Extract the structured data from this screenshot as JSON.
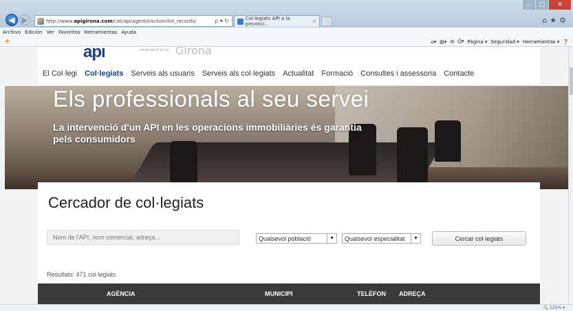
{
  "browser": {
    "url_prefix": "http://www.",
    "url_host": "apigirona.com",
    "url_path": "/cat/api/agent/i/action/list_records/",
    "url_tools": "ρ ▾ ↻",
    "tab_title": "Col·legiats API a la provinci...",
    "tab_close": "×",
    "menu": [
      "Archivo",
      "Edición",
      "Ver",
      "Favoritos",
      "Herramientas",
      "Ayuda"
    ],
    "command_bar": [
      "Página ▾",
      "Seguridad ▾",
      "Herramientas ▾"
    ],
    "zoom": "🔍 125% ▾"
  },
  "site": {
    "logo": "api",
    "logo_sub": "immobiliaria",
    "logo_city": "Girona",
    "nav": [
      {
        "label": "El Col·legi",
        "active": false
      },
      {
        "label": "Col·legiats",
        "active": true
      },
      {
        "label": "Serveis als usuaris",
        "active": false
      },
      {
        "label": "Serveis als col·legiats",
        "active": false
      },
      {
        "label": "Actualitat",
        "active": false
      },
      {
        "label": "Formació",
        "active": false
      },
      {
        "label": "Consultes i assessoria",
        "active": false
      },
      {
        "label": "Contacte",
        "active": false
      }
    ],
    "hero_title": "Els professionals al seu servei",
    "hero_subtitle": "La intervenció d'un API en les operacions immobiliàries és garantia pels consumidors"
  },
  "search": {
    "title": "Cercador de col·legiats",
    "placeholder": "Nom de l'API, nom comercial, adreça...",
    "poblacio": "Qualsevol població",
    "especialitat": "Qualsevol especialitat",
    "button": "Cercar col·legiats",
    "results": "Resultats: 471 col·legiats"
  },
  "table": {
    "columns": [
      "AGÈNCIA",
      "MUNICIPI",
      "TELÈFON",
      "ADREÇA"
    ]
  }
}
